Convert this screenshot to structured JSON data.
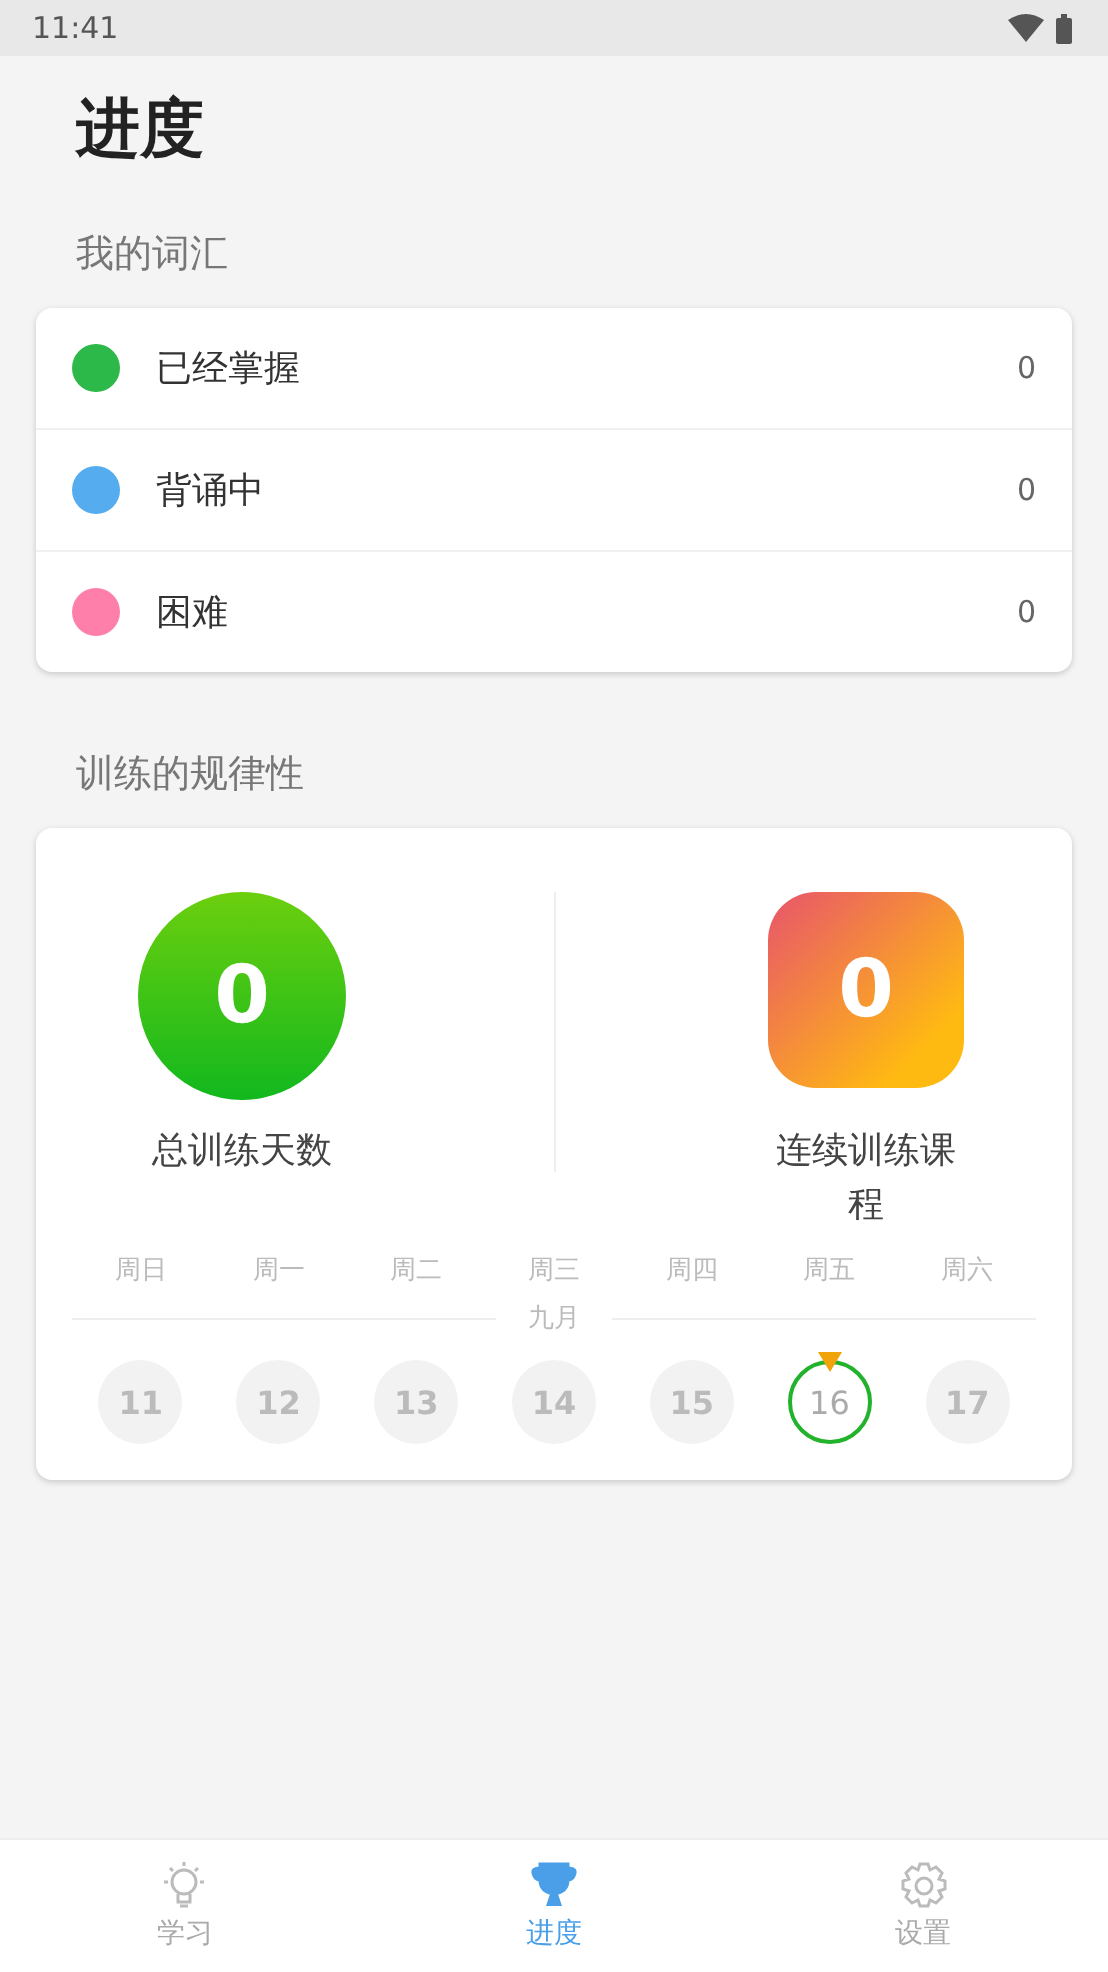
{
  "status_bar": {
    "time": "11:41"
  },
  "title": "进度",
  "vocabulary": {
    "heading": "我的词汇",
    "items": [
      {
        "label": "已经掌握",
        "count": "0",
        "color": "#2db84a"
      },
      {
        "label": "背诵中",
        "count": "0",
        "color": "#55acee"
      },
      {
        "label": "困难",
        "count": "0",
        "color": "#ff7fab"
      }
    ]
  },
  "training": {
    "heading": "训练的规律性",
    "total_days": {
      "value": "0",
      "label": "总训练天数"
    },
    "streak": {
      "value": "0",
      "label": "连续训练课程"
    },
    "weekdays": [
      "周日",
      "周一",
      "周二",
      "周三",
      "周四",
      "周五",
      "周六"
    ],
    "month": "九月",
    "days": [
      {
        "day": "11",
        "selected": false
      },
      {
        "day": "12",
        "selected": false
      },
      {
        "day": "13",
        "selected": false
      },
      {
        "day": "14",
        "selected": false
      },
      {
        "day": "15",
        "selected": false
      },
      {
        "day": "16",
        "selected": true
      },
      {
        "day": "17",
        "selected": false
      }
    ]
  },
  "tabs": [
    {
      "label": "学习",
      "kind": "bulb",
      "selected": false
    },
    {
      "label": "进度",
      "kind": "trophy",
      "selected": true
    },
    {
      "label": "设置",
      "kind": "gear",
      "selected": false
    }
  ]
}
